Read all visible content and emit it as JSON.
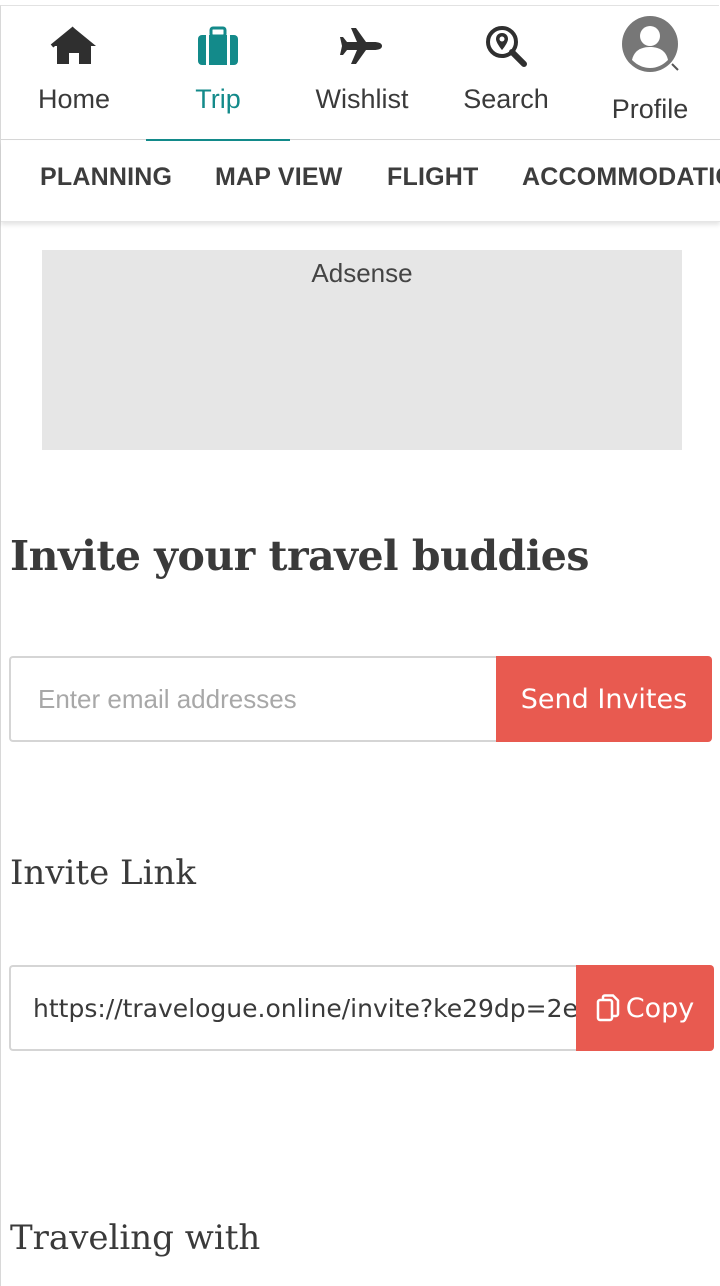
{
  "nav": {
    "items": [
      {
        "label": "Home",
        "icon": "home-icon"
      },
      {
        "label": "Trip",
        "icon": "suitcase-icon"
      },
      {
        "label": "Wishlist",
        "icon": "airplane-icon"
      },
      {
        "label": "Search",
        "icon": "search-location-icon"
      },
      {
        "label": "Profile",
        "icon": "user-avatar-icon"
      }
    ],
    "active": "Trip"
  },
  "subnav": {
    "tabs": [
      "PLANNING",
      "MAP VIEW",
      "FLIGHT",
      "ACCOMMODATIC"
    ]
  },
  "ad": {
    "label": "Adsense"
  },
  "invite": {
    "title": "Invite your travel buddies",
    "email_placeholder": "Enter email addresses",
    "send_label": "Send Invites"
  },
  "invite_link": {
    "title": "Invite Link",
    "url": "https://travelogue.online/invite?ke29dp=2e",
    "copy_label": "Copy"
  },
  "traveling": {
    "title": "Traveling with"
  },
  "colors": {
    "accent": "#138a8a",
    "button": "#e85a50",
    "ad_bg": "#e6e6e6"
  }
}
